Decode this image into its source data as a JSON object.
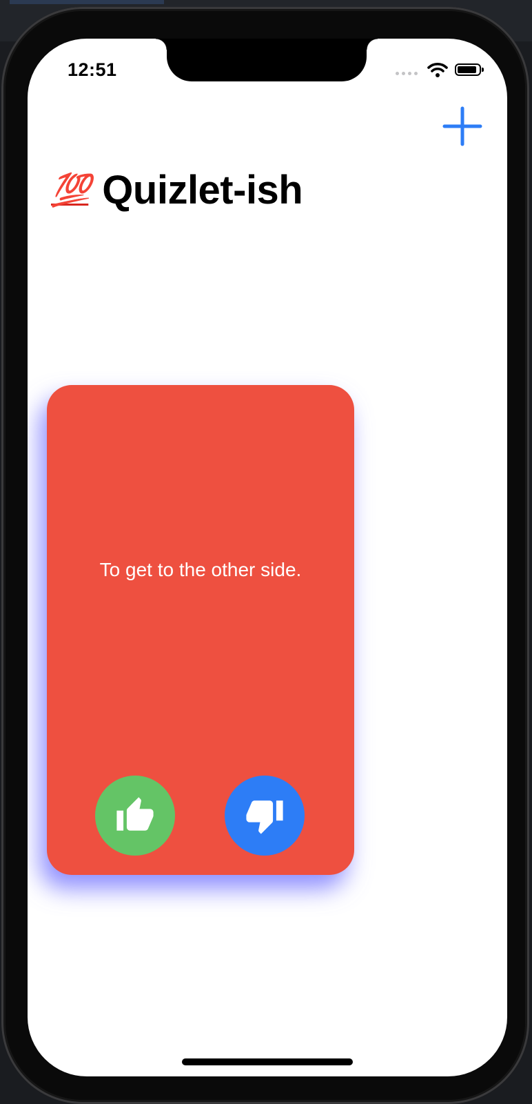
{
  "status_bar": {
    "time": "12:51",
    "icons": [
      "cellular-signal-icon",
      "wifi-icon",
      "battery-icon"
    ],
    "battery_level": 0.9
  },
  "nav_bar": {
    "add_icon": "plus-icon"
  },
  "header": {
    "emoji": "💯",
    "emoji_name": "hundred-points-icon",
    "title": "Quizlet-ish"
  },
  "card": {
    "text": "To get to the other side.",
    "like_icon": "thumbs-up-icon",
    "dislike_icon": "thumbs-down-icon"
  },
  "colors": {
    "accent": "#2d7df6",
    "card": "#ee5040",
    "card_shadow": "#6969ff",
    "like": "#64c466",
    "dislike": "#2d7df6",
    "background": "#ffffff",
    "emoji_red": "#d8261e"
  }
}
